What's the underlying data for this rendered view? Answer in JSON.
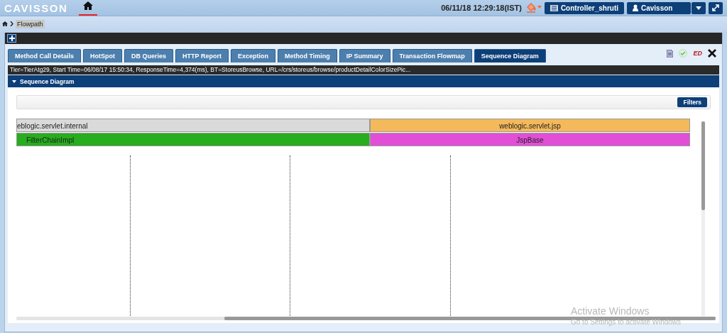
{
  "header": {
    "logo": "CAVISSON",
    "datetime": "06/11/18 12:29:18(IST)",
    "controller_button": "Controller_shruti",
    "user_button": "Cavisson"
  },
  "breadcrumb": {
    "current": "Flowpath"
  },
  "tabs": [
    {
      "label": "Method Call Details",
      "selected": false
    },
    {
      "label": "HotSpot",
      "selected": false
    },
    {
      "label": "DB Queries",
      "selected": false
    },
    {
      "label": "HTTP Report",
      "selected": false
    },
    {
      "label": "Exception",
      "selected": false
    },
    {
      "label": "Method Timing",
      "selected": false
    },
    {
      "label": "IP Summary",
      "selected": false
    },
    {
      "label": "Transaction Flowmap",
      "selected": false
    },
    {
      "label": "Sequence Diagram",
      "selected": true
    }
  ],
  "toolbar": {
    "ed_label": "ED"
  },
  "info_bar": "Tier=TierAtg29, Start Time=06/08/17 15:50:34, ResponseTime=4,374(ms), BT=StoreusBrowse, URL=/crs/storeus/browse/productDetailColorSizePic...",
  "section": {
    "title": "Sequence Diagram",
    "expanded": true
  },
  "filters_button": "Filters",
  "packages": [
    {
      "name": "eblogic.servlet.internal",
      "color": "#dadada",
      "clipped": true
    },
    {
      "name": "weblogic.servlet.jsp",
      "color": "#f4b95a",
      "clipped": false
    }
  ],
  "classes": [
    {
      "name": "FilterChainImpl",
      "color": "#27ad1d",
      "clipped": true
    },
    {
      "name": "JspBase",
      "color": "#e14fd6",
      "clipped": false
    }
  ],
  "os_notice": {
    "title": "Activate Windows",
    "subtitle": "Go to Settings to activate Windows"
  }
}
